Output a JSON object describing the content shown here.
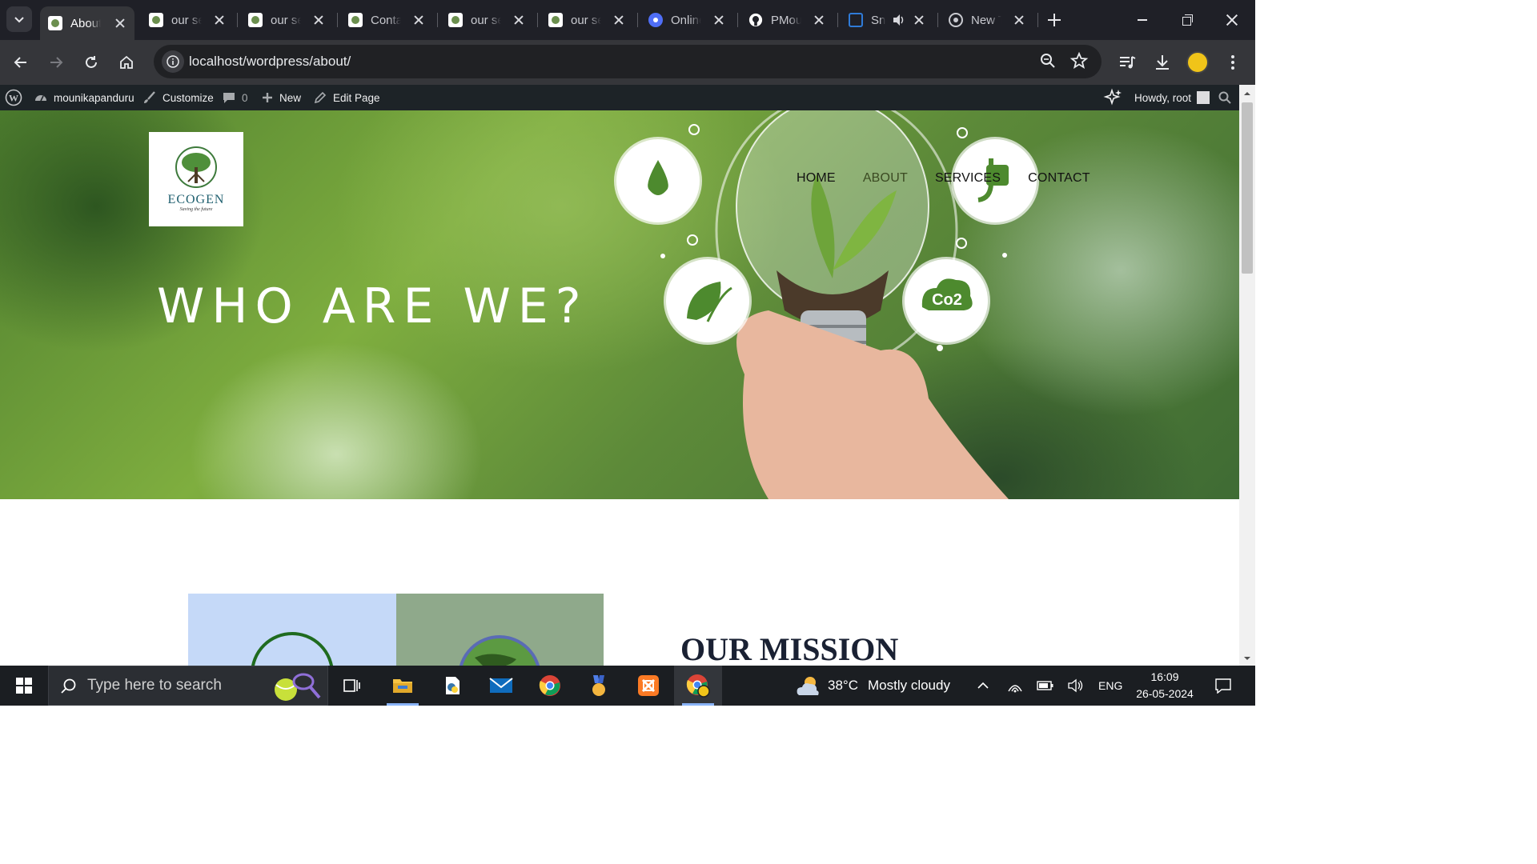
{
  "browser": {
    "tabs": [
      {
        "title": "About",
        "active": true
      },
      {
        "title": "our services",
        "active": false
      },
      {
        "title": "our services",
        "active": false
      },
      {
        "title": "Contact",
        "active": false
      },
      {
        "title": "our services",
        "active": false
      },
      {
        "title": "our services",
        "active": false
      },
      {
        "title": "Online",
        "active": false
      },
      {
        "title": "PMou",
        "active": false
      },
      {
        "title": "Sn",
        "active": false
      },
      {
        "title": "New Tab",
        "active": false
      }
    ],
    "url": "localhost/wordpress/about/"
  },
  "adminbar": {
    "site_name": "mounikapanduru",
    "customize": "Customize",
    "comments_count": "0",
    "new": "New",
    "edit_page": "Edit Page",
    "howdy": "Howdy, root"
  },
  "site": {
    "logo_name": "ECOGEN",
    "logo_tagline": "Saving the future",
    "nav": [
      "HOME",
      "ABOUT",
      "SERVICES",
      "CONTACT"
    ],
    "active_nav": "ABOUT",
    "hero_title": "WHO ARE WE?",
    "mission_title": "OUR MISSION",
    "icon_bubble_text": "Co2"
  },
  "taskbar": {
    "search_placeholder": "Type here to search",
    "temperature": "38°C",
    "weather": "Mostly cloudy",
    "language": "ENG",
    "time": "16:09",
    "date": "26-05-2024"
  },
  "colors": {
    "chrome_dark": "#1f2027",
    "toolbar": "#35363a",
    "wp_adminbar": "#1d2327",
    "taskbar": "#1b1e22",
    "accent_blue": "#8ab4f8"
  }
}
